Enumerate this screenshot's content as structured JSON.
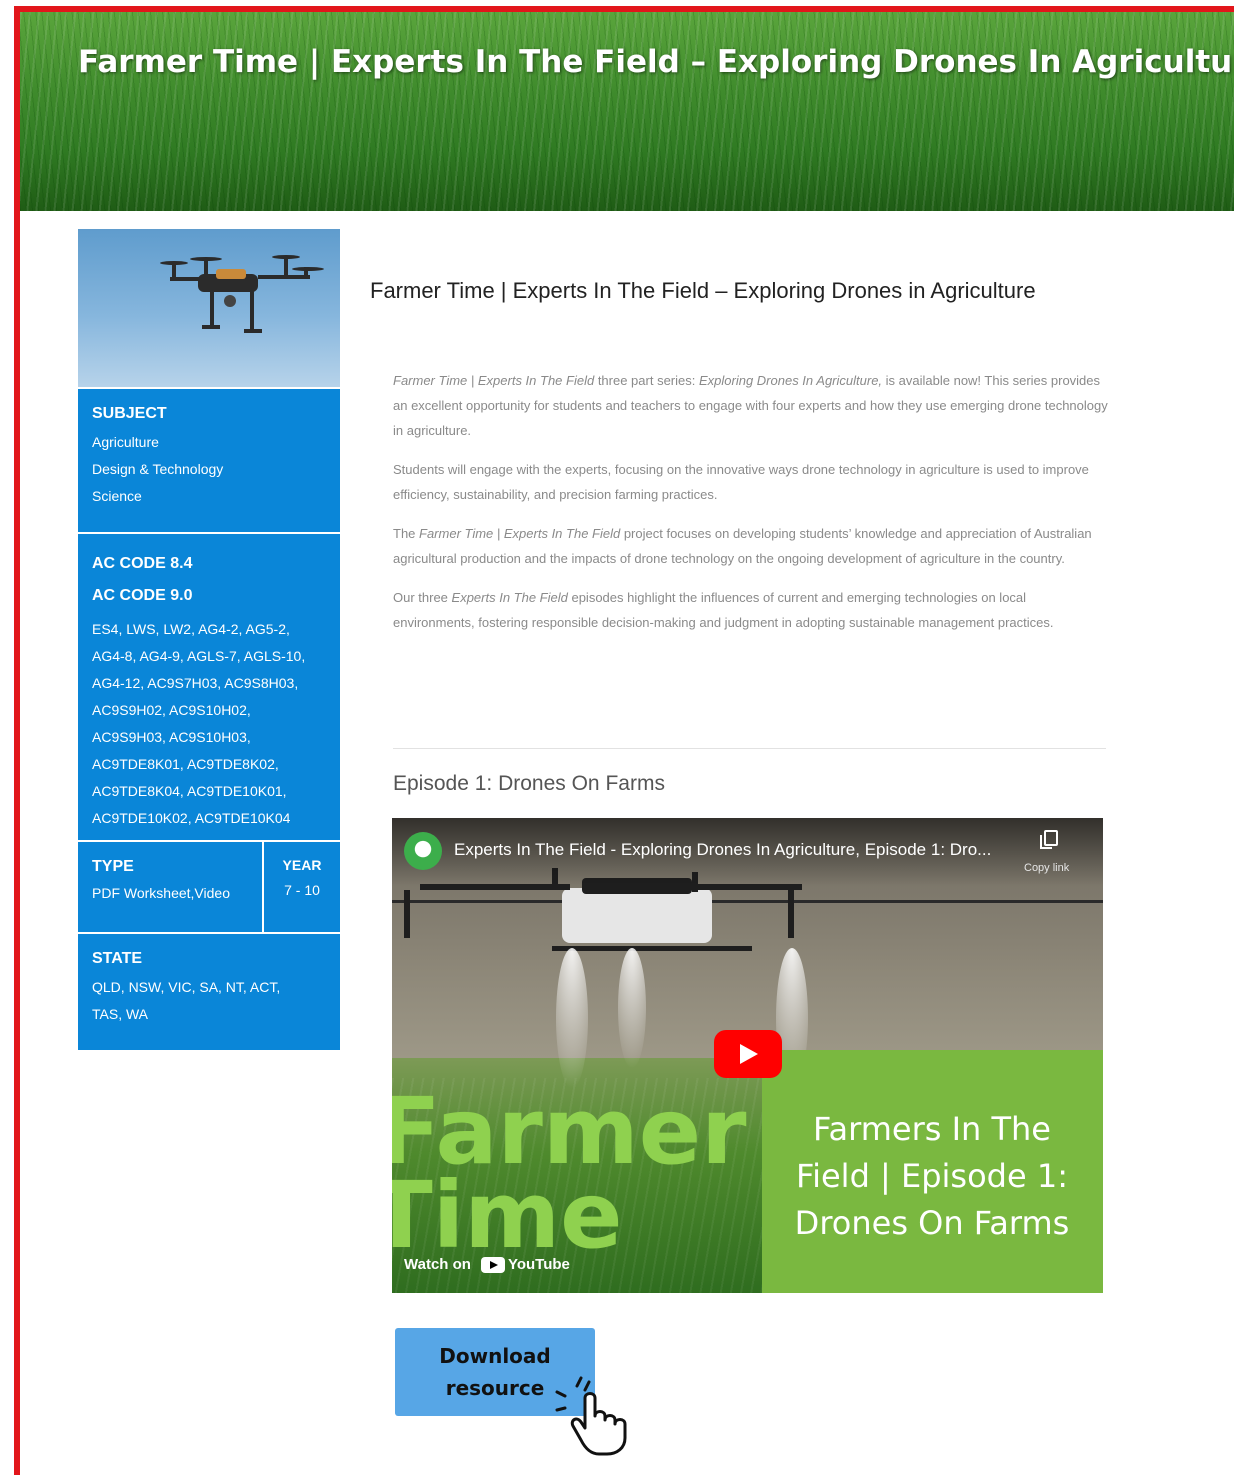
{
  "banner": {
    "title": "Farmer Time | Experts In The Field – Exploring Drones In Agriculture"
  },
  "sidebar": {
    "subject": {
      "heading": "SUBJECT",
      "items": [
        "Agriculture",
        "Design & Technology",
        "Science"
      ]
    },
    "ac": {
      "heading1": "AC CODE 8.4",
      "heading2": "AC CODE 9.0",
      "codes": [
        "ES4, LWS, LW2, AG4-2, AG5-2,",
        "AG4-8, AG4-9, AGLS-7, AGLS-10,",
        "AG4-12, AC9S7H03, AC9S8H03,",
        "AC9S9H02, AC9S10H02,",
        "AC9S9H03, AC9S10H03,",
        "AC9TDE8K01, AC9TDE8K02,",
        "AC9TDE8K04, AC9TDE10K01,",
        "AC9TDE10K02, AC9TDE10K04"
      ]
    },
    "type": {
      "heading": "TYPE",
      "value": "PDF Worksheet,Video"
    },
    "year": {
      "heading": "YEAR",
      "value": "7 - 10"
    },
    "state": {
      "heading": "STATE",
      "lines": [
        "QLD, NSW, VIC, SA, NT, ACT,",
        "TAS, WA"
      ]
    }
  },
  "main": {
    "title": "Farmer Time | Experts In The Field – Exploring Drones in Agriculture",
    "paragraphs": [
      {
        "segments": [
          {
            "t": "Farmer Time | Experts In The Field",
            "i": true
          },
          {
            "t": " three part series: ",
            "i": false
          },
          {
            "t": "Exploring Drones In Agriculture,",
            "i": true
          },
          {
            "t": " is available now! This series provides an excellent opportunity for students and teachers to engage with four experts and how they use emerging drone technology in agriculture.",
            "i": false
          }
        ]
      },
      {
        "segments": [
          {
            "t": "Students will engage with the experts, focusing on the innovative ways drone technology in agriculture is used to improve efficiency, sustainability, and precision farming practices.",
            "i": false
          }
        ]
      },
      {
        "segments": [
          {
            "t": "The ",
            "i": false
          },
          {
            "t": "Farmer Time | Experts In The Field",
            "i": true
          },
          {
            "t": " project focuses on developing students’ knowledge and appreciation of Australian agricultural production and the impacts of drone technology on the ongoing development of agriculture in the country.",
            "i": false
          }
        ]
      },
      {
        "segments": [
          {
            "t": "Our three ",
            "i": false
          },
          {
            "t": "Experts In The Field",
            "i": true
          },
          {
            "t": " episodes highlight the influences of current and emerging technologies on local environments, fostering responsible decision-making and judgment in adopting sustainable management practices.",
            "i": false
          }
        ]
      }
    ],
    "episode_title": "Episode 1: Drones On Farms"
  },
  "video": {
    "title": "Experts In The Field - Exploring Drones In Agriculture, Episode 1: Dro...",
    "copy_label": "Copy link",
    "big_line1": "Farmer",
    "big_line2": "Time",
    "panel_text": "Farmers In The\nField | Episode 1:\nDrones On Farms",
    "watch_on": "Watch on",
    "youtube": "YouTube"
  },
  "download": {
    "label": "Download\nresource"
  },
  "colors": {
    "accent_red": "#e2161b",
    "sidebar_blue": "#0a86d8",
    "button_blue": "#57a6e6",
    "panel_green": "#7ab840"
  },
  "icons": [
    "drone-photo",
    "channel-logo-icon",
    "copy-link-icon",
    "play-button-icon",
    "youtube-logo-icon",
    "hand-pointer-icon"
  ]
}
